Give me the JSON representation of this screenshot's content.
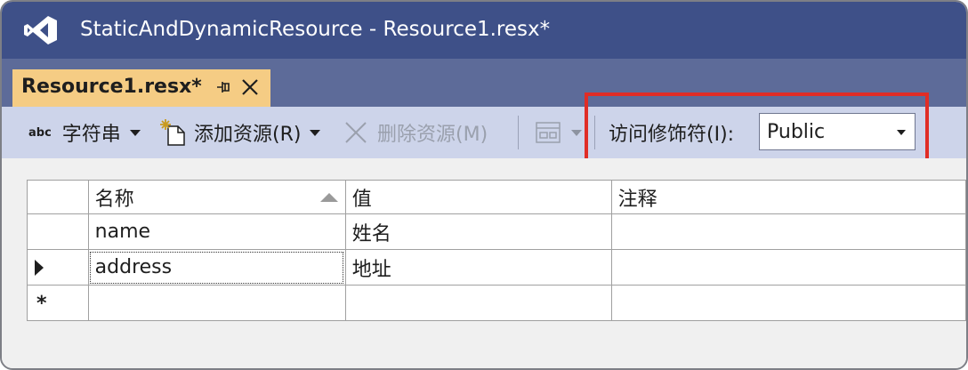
{
  "window": {
    "title": "StaticAndDynamicResource - Resource1.resx*"
  },
  "tab": {
    "label": "Resource1.resx*"
  },
  "toolbar": {
    "strings_abc": "abc",
    "strings_label": "字符串",
    "add_resource_label": "添加资源(R)",
    "remove_resource_label": "删除资源(M)",
    "access_modifier_label": "访问修饰符(I):",
    "access_modifier_value": "Public"
  },
  "grid": {
    "columns": [
      "名称",
      "值",
      "注释"
    ],
    "rows": [
      {
        "name": "name",
        "value": "姓名",
        "comment": ""
      },
      {
        "name": "address",
        "value": "地址",
        "comment": ""
      }
    ],
    "new_row_marker": "*"
  },
  "colors": {
    "titlebar": "#3e5088",
    "tabstrip": "#5d6b99",
    "active_tab": "#f5cc84",
    "toolbar": "#cdd4ea",
    "highlight": "#e02d26"
  }
}
